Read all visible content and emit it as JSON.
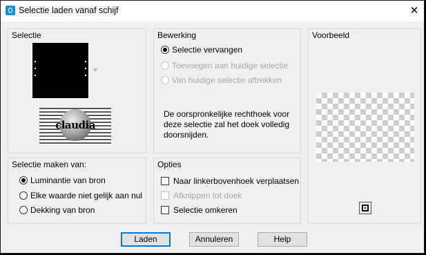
{
  "window": {
    "title": "Selectie laden vanaf schijf",
    "close_glyph": "✕"
  },
  "selectie": {
    "label": "Selectie",
    "thumbnail_caption": "claudia"
  },
  "bewerking": {
    "label": "Bewerking",
    "options": [
      {
        "label": "Selectie vervangen",
        "checked": true,
        "enabled": true
      },
      {
        "label": "Toevoegen aan huidige selectie",
        "checked": false,
        "enabled": false
      },
      {
        "label": "Van huidige selectie aftrekken",
        "checked": false,
        "enabled": false
      }
    ],
    "info_text": "De oorspronkelijke rechthoek voor deze selectie zal het doek volledig doorsnijden."
  },
  "voorbeeld": {
    "label": "Voorbeeld"
  },
  "maken_van": {
    "label": "Selectie maken van:",
    "options": [
      {
        "label": "Luminantie van bron",
        "checked": true
      },
      {
        "label": "Elke waarde niet gelijk aan nul",
        "checked": false
      },
      {
        "label": "Dekking van bron",
        "checked": false
      }
    ]
  },
  "opties": {
    "label": "Opties",
    "options": [
      {
        "label": "Naar linkerbovenhoek verplaatsen",
        "checked": false,
        "enabled": true
      },
      {
        "label": "Afknippen tot doek",
        "checked": false,
        "enabled": false
      },
      {
        "label": "Selectie omkeren",
        "checked": false,
        "enabled": true
      }
    ]
  },
  "buttons": {
    "laden": "Laden",
    "annuleren": "Annuleren",
    "help": "Help"
  },
  "icons": {
    "app": "app-icon",
    "close": "close-icon",
    "preview_toggle": "preview-toggle-icon"
  }
}
